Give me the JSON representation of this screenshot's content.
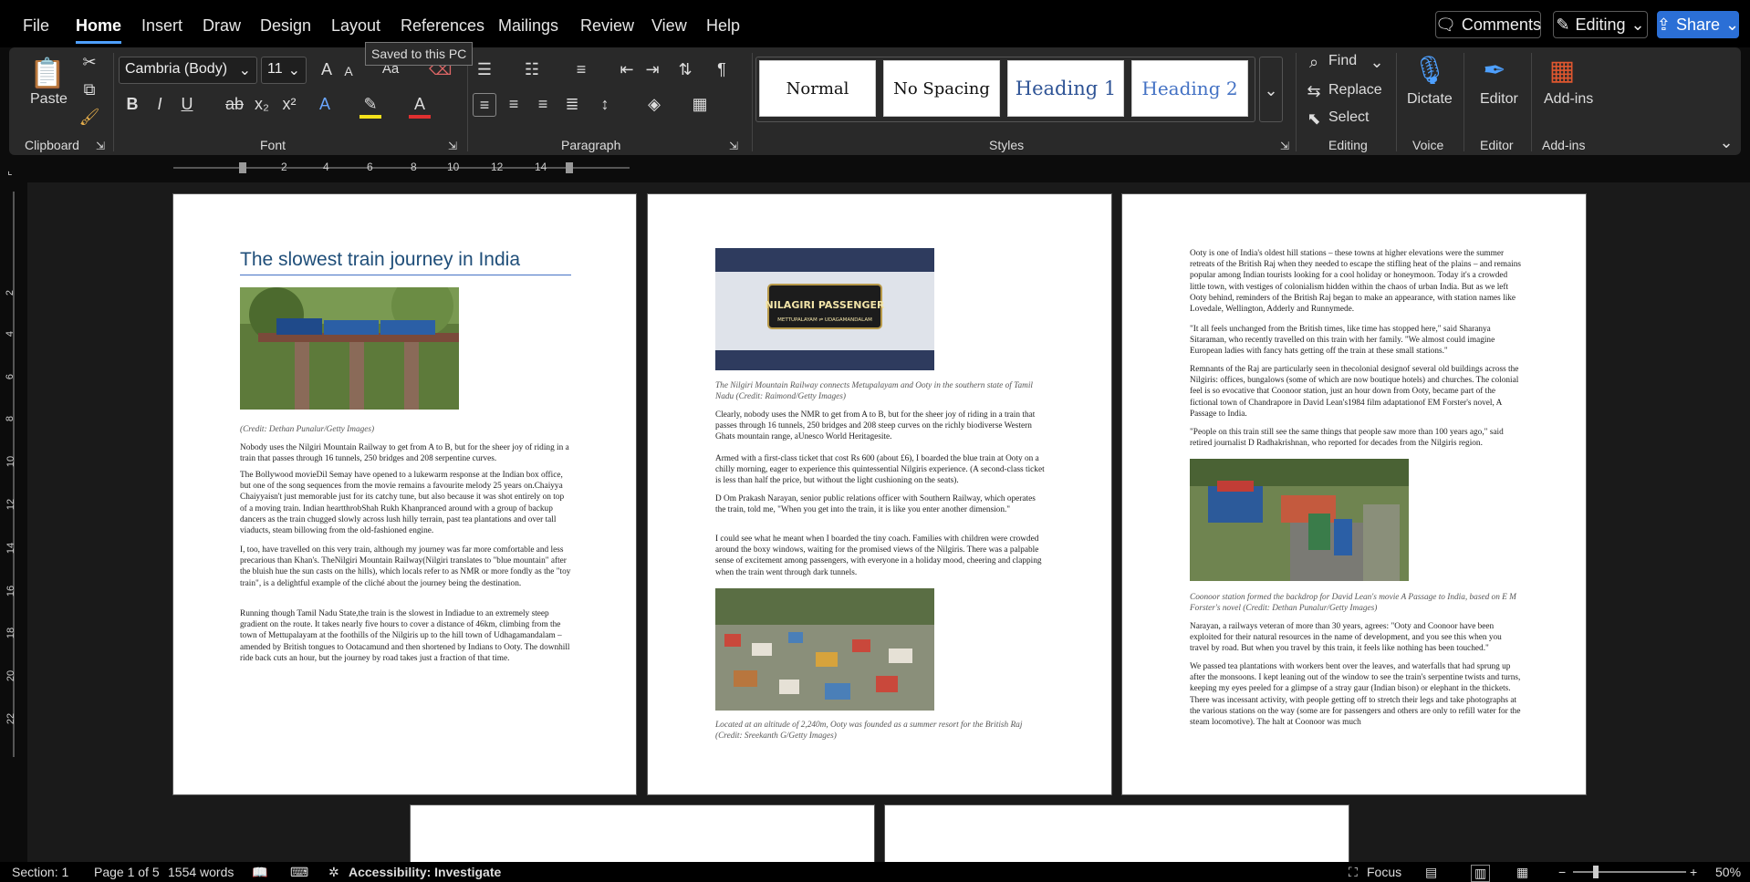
{
  "menu": {
    "file": "File",
    "home": "Home",
    "insert": "Insert",
    "draw": "Draw",
    "design": "Design",
    "layout": "Layout",
    "references": "References",
    "mailings": "Mailings",
    "review": "Review",
    "view": "View",
    "help": "Help"
  },
  "top_actions": {
    "comments": "Comments",
    "editing": "Editing",
    "share": "Share"
  },
  "tooltip": "Saved to this PC",
  "ribbon": {
    "clipboard": {
      "paste": "Paste",
      "label": "Clipboard"
    },
    "font": {
      "name": "Cambria (Body)",
      "size": "11",
      "label": "Font",
      "case": "Aa"
    },
    "paragraph": {
      "label": "Paragraph"
    },
    "styles": {
      "label": "Styles",
      "items": [
        "Normal",
        "No Spacing",
        "Heading 1",
        "Heading 2"
      ]
    },
    "editing": {
      "find": "Find",
      "replace": "Replace",
      "select": "Select",
      "label": "Editing"
    },
    "voice": {
      "dictate": "Dictate",
      "label": "Voice"
    },
    "editor": {
      "editor": "Editor",
      "label": "Editor"
    },
    "addins": {
      "addins": "Add-ins",
      "label": "Add-ins"
    }
  },
  "ruler": {
    "ticks": [
      "2",
      "4",
      "6",
      "8",
      "10",
      "12",
      "14"
    ],
    "vticks": [
      "2",
      "4",
      "6",
      "8",
      "10",
      "12",
      "14",
      "16",
      "18",
      "20",
      "22"
    ]
  },
  "page1": {
    "title": "The slowest train journey in India",
    "caption": "(Credit: Dethan Punalur/Getty Images)",
    "p1": "Nobody uses the Nilgiri Mountain Railway to get from A to B, but for the sheer joy of riding in a train that passes through 16 tunnels, 250 bridges and 208 serpentine curves.",
    "p2": "The Bollywood movieDil Semay have opened to a lukewarm response at the Indian box office, but one of the song sequences from the movie remains a favourite melody 25 years on.Chaiyya Chaiyyaisn't just memorable just for its catchy tune, but also because it was shot entirely on top of a moving train. Indian heartthrobShah Rukh Khanpranced around with a group of backup dancers as the train chugged slowly across lush hilly terrain, past tea plantations and over tall viaducts, steam billowing from the old-fashioned engine.",
    "p3": "I, too, have travelled on this very train, although my journey was far more comfortable and less precarious than Khan's. TheNilgiri Mountain Railway(Nilgiri translates to \"blue mountain\" after the bluish hue the sun casts on the hills), which locals refer to as NMR or more fondly as the \"toy train\", is a delightful example of the cliché about the journey being the destination.",
    "p4": "Running though Tamil Nadu State,the train is the slowest in Indiadue to an extremely steep gradient on the route. It takes nearly five hours to cover a distance of 46km, climbing from the town of Mettupalayam at the foothills of the Nilgiris up to the hill town of Udhagamandalam – amended by British tongues to Ootacamund and then shortened by Indians to Ooty. The downhill ride back cuts an hour, but the journey by road takes just a fraction of that time."
  },
  "page2": {
    "sign_line1": "NILAGIRI PASSENGER",
    "sign_line2": "METTUPALAYAM ⇌ UDAGAMANDALAM",
    "caption1": "The Nilgiri Mountain Railway connects Metupalayam and Ooty in the southern state of Tamil Nadu (Credit: Raimond/Getty Images)",
    "p1": "Clearly, nobody uses the NMR to get from A to B, but for the sheer joy of riding in a train that passes through 16 tunnels, 250 bridges and 208 steep curves on the richly biodiverse Western Ghats mountain range, aUnesco World Heritagesite.",
    "p2": "Armed with a first-class ticket that cost Rs 600 (about £6), I boarded the blue train at Ooty on a chilly morning, eager to experience this quintessential Nilgiris experience. (A second-class ticket is less than half the price, but without the light cushioning on the seats).",
    "p3": "D Om Prakash Narayan, senior public relations officer with Southern Railway, which operates the train, told me, \"When you get into the train, it is like you enter another dimension.\"",
    "p4": "I could see what he meant when I boarded the tiny coach. Families with children were crowded around the boxy windows, waiting for the promised views of the Nilgiris. There was a palpable sense of excitement among passengers, with everyone in a holiday mood, cheering and clapping when the train went through dark tunnels.",
    "caption2": "Located at an altitude of 2,240m, Ooty was founded as a summer resort for the British Raj (Credit: Sreekanth G/Getty Images)"
  },
  "page3": {
    "p1": "Ooty is one of India's oldest hill stations – these towns at higher elevations were the summer retreats of the British Raj when they needed to escape the stifling heat of the plains – and remains popular among Indian tourists looking for a cool holiday or honeymoon. Today it's a crowded little town, with vestiges of colonialism hidden within the chaos of urban India. But as we left Ooty behind, reminders of the British Raj began to make an appearance, with station names like Lovedale, Wellington, Adderly and Runnymede.",
    "p2": "\"It all feels unchanged from the British times, like time has stopped here,\" said Sharanya Sitaraman, who recently travelled on this train with her family. \"We almost could imagine European ladies with fancy hats getting off the train at these small stations.\"",
    "p3": "Remnants of the Raj are particularly seen in thecolonial designof several old buildings across the Nilgiris: offices, bungalows (some of which are now boutique hotels) and churches. The colonial feel is so evocative that Coonoor station, just an hour down from Ooty, became part of the fictional town of Chandrapore in David Lean's1984 film adaptationof EM Forster's novel, A Passage to India.",
    "p4": "\"People on this train still see the same things that people saw more than 100 years ago,\" said retired journalist D Radhakrishnan, who reported for decades from the Nilgiris region.",
    "caption": "Coonoor station formed the backdrop for David Lean's movie A Passage to India, based on E M Forster's novel (Credit: Dethan Punalur/Getty Images)",
    "p5": "Narayan, a railways veteran of more than 30 years, agrees: \"Ooty and Coonoor have been exploited for their natural resources in the name of development, and you see this when you travel by road. But when you travel by this train, it feels like nothing has been touched.\"",
    "p6": "We passed tea plantations with workers bent over the leaves, and waterfalls that had sprung up after the monsoons. I kept leaning out of the window to see the train's serpentine twists and turns, keeping my eyes peeled for a glimpse of a stray gaur (Indian bison) or elephant in the thickets. There was incessant activity, with people getting off to stretch their legs and take photographs at the various stations on the way (some are for passengers and others are only to refill water for the steam locomotive). The halt at Coonoor was much"
  },
  "status": {
    "section": "Section: 1",
    "page": "Page 1 of 5",
    "words": "1554 words",
    "accessibility": "Accessibility: Investigate",
    "focus": "Focus",
    "zoom": "50%"
  }
}
